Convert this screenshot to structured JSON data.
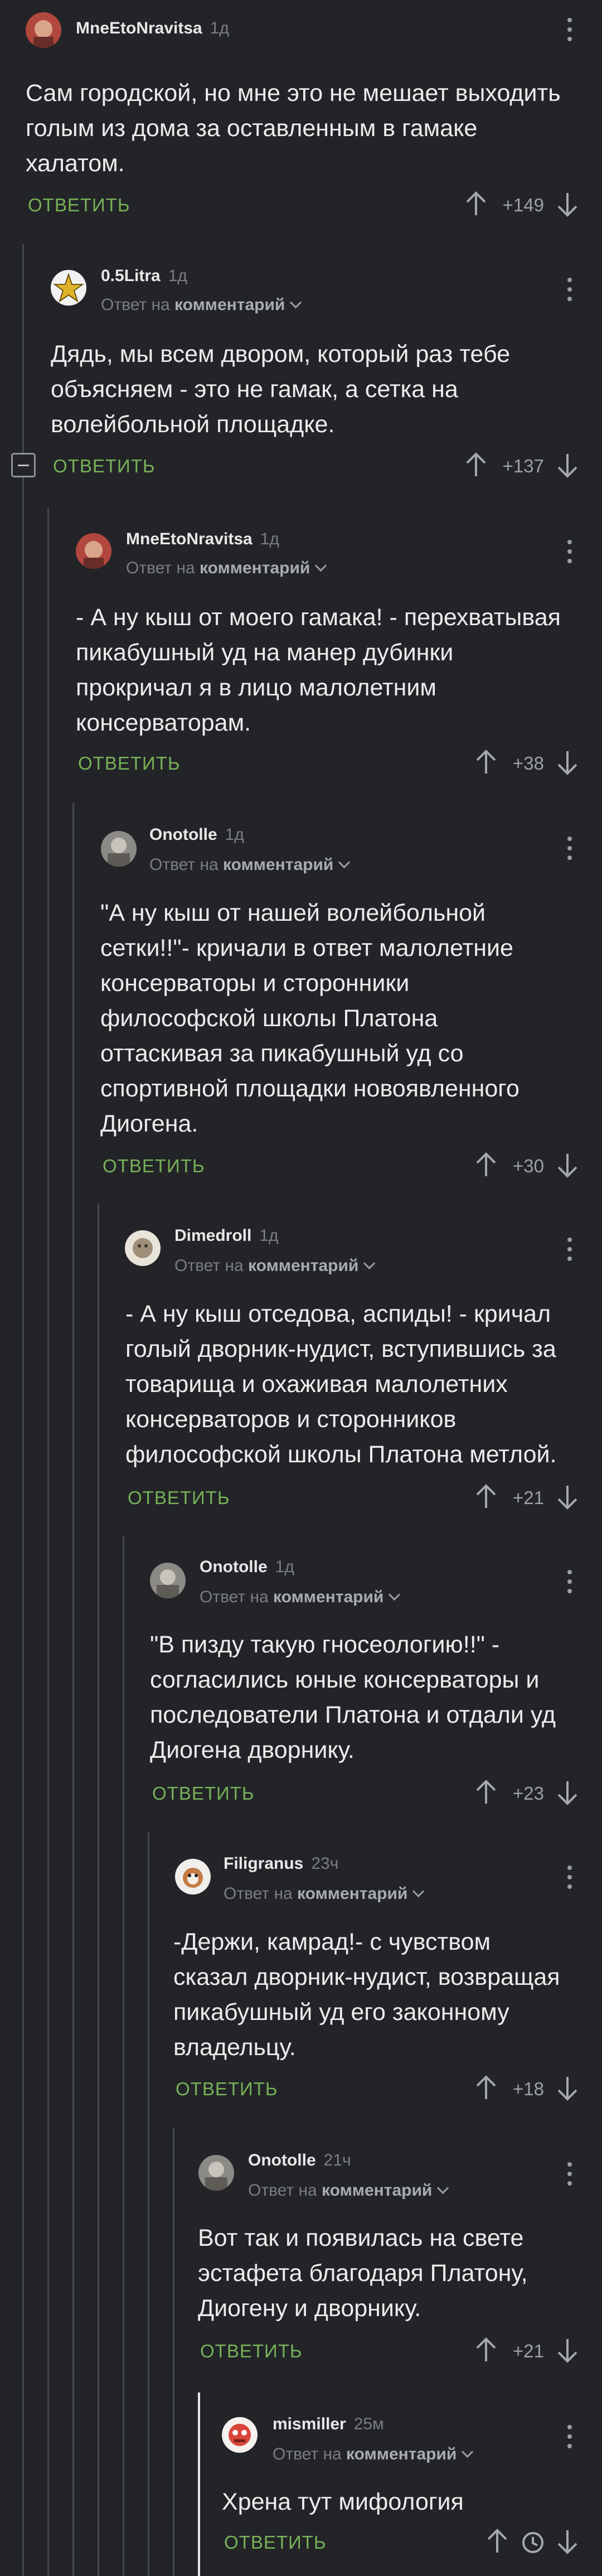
{
  "comments": [
    {
      "author": "MneEtoNravitsa",
      "time": "1д",
      "reply_prefix": "",
      "reply_target": "",
      "text": "Сам городской, но мне это не мешает выходить голым из дома за оставленным в гамаке халатом.",
      "reply_label": "ОТВЕТИТЬ",
      "rating": "+149"
    },
    {
      "author": "0.5Litra",
      "time": "1д",
      "reply_prefix": "Ответ на",
      "reply_target": "комментарий",
      "text": "Дядь, мы всем двором, который раз тебе объясняем - это не гамак, а сетка на волейбольной площадке.",
      "reply_label": "ОТВЕТИТЬ",
      "rating": "+137"
    },
    {
      "author": "MneEtoNravitsa",
      "time": "1д",
      "reply_prefix": "Ответ на",
      "reply_target": "комментарий",
      "text": "- А ну кыш от моего гамака! - перехватывая пикабушный уд на манер дубинки прокричал я в лицо малолетним консерваторам.",
      "reply_label": "ОТВЕТИТЬ",
      "rating": "+38"
    },
    {
      "author": "Onotolle",
      "time": "1д",
      "reply_prefix": "Ответ на",
      "reply_target": "комментарий",
      "text": "\"А ну кыш от нашей волейбольной сетки!!\"- кричали в ответ малолетние консерваторы и сторонники философской школы Платона оттаскивая за пикабушный уд со спортивной  площадки новоявленного Диогена.",
      "reply_label": "ОТВЕТИТЬ",
      "rating": "+30"
    },
    {
      "author": "Dimedroll",
      "time": "1д",
      "reply_prefix": "Ответ на",
      "reply_target": "комментарий",
      "text": "- А ну кыш отседова, аспиды! - кричал голый дворник-нудист, вступившись за товарища и охаживая малолетних консерваторов и сторонников философской школы Платона метлой.",
      "reply_label": "ОТВЕТИТЬ",
      "rating": "+21"
    },
    {
      "author": "Onotolle",
      "time": "1д",
      "reply_prefix": "Ответ на",
      "reply_target": "комментарий",
      "text": "\"В пизду такую гносеологию!!\" - согласились юные консерваторы и последователи Платона и отдали уд Диогена дворнику.",
      "reply_label": "ОТВЕТИТЬ",
      "rating": "+23"
    },
    {
      "author": "Filigranus",
      "time": "23ч",
      "reply_prefix": "Ответ на",
      "reply_target": "комментарий",
      "text": "-Держи, камрад!- с чувством сказал дворник-нудист, возвращая пикабушный уд его законному владельцу.",
      "reply_label": "ОТВЕТИТЬ",
      "rating": "+18"
    },
    {
      "author": "Onotolle",
      "time": "21ч",
      "reply_prefix": "Ответ на",
      "reply_target": "комментарий",
      "text": "Вот так и появилась на свете эстафета благодаря Платону, Диогену и дворнику.",
      "reply_label": "ОТВЕТИТЬ",
      "rating": "+21"
    },
    {
      "author": "mismiller",
      "time": "25м",
      "reply_prefix": "Ответ на",
      "reply_target": "комментарий",
      "text": "Хрена тут мифология",
      "reply_label": "ОТВЕТИТЬ",
      "rating": ""
    }
  ],
  "colors": {
    "background": "#222428",
    "reply": "#78b157",
    "thread_line": "#45484d",
    "active_line": "#e7e7e7"
  }
}
